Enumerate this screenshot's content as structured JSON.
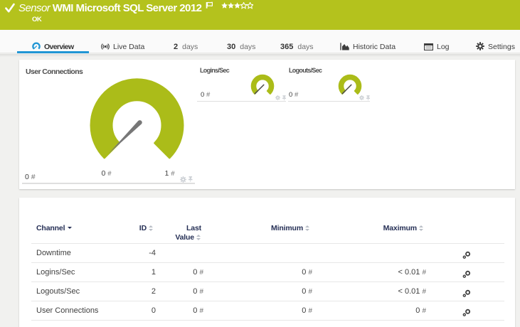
{
  "header": {
    "type_label": "Sensor",
    "title": "WMI Microsoft SQL Server 2012",
    "status": "OK",
    "rating": {
      "filled": 3,
      "total": 5
    },
    "colors": {
      "bar_green": "#b4c21d",
      "accent_blue": "#2196d4",
      "gauge_green": "#abbc19"
    }
  },
  "tabs": {
    "overview": {
      "label": "Overview"
    },
    "live_data": {
      "label": "Live Data"
    },
    "days2": {
      "num": "2",
      "unit": "days"
    },
    "days30": {
      "num": "30",
      "unit": "days"
    },
    "days365": {
      "num": "365",
      "unit": "days"
    },
    "historic": {
      "label": "Historic Data"
    },
    "log": {
      "label": "Log"
    },
    "settings": {
      "label": "Settings"
    }
  },
  "gauges": {
    "main": {
      "title": "User Connections",
      "value": "0",
      "unit": "#",
      "scale_min": "0",
      "scale_min_unit": "#",
      "scale_max": "1",
      "scale_max_unit": "#"
    },
    "tile1": {
      "title": "Logins/Sec",
      "value": "0",
      "unit": "#"
    },
    "tile2": {
      "title": "Logouts/Sec",
      "value": "0",
      "unit": "#"
    }
  },
  "table": {
    "columns": {
      "channel": "Channel",
      "id": "ID",
      "last1": "Last",
      "last2": "Value",
      "min": "Minimum",
      "max": "Maximum"
    },
    "rows": [
      {
        "channel": "Downtime",
        "id": "-4",
        "last": "",
        "last_unit": "",
        "min": "",
        "min_unit": "",
        "max": "",
        "max_unit": ""
      },
      {
        "channel": "Logins/Sec",
        "id": "1",
        "last": "0",
        "last_unit": "#",
        "min": "0",
        "min_unit": "#",
        "max": "< 0.01",
        "max_unit": "#"
      },
      {
        "channel": "Logouts/Sec",
        "id": "2",
        "last": "0",
        "last_unit": "#",
        "min": "0",
        "min_unit": "#",
        "max": "< 0.01",
        "max_unit": "#"
      },
      {
        "channel": "User Connections",
        "id": "0",
        "last": "0",
        "last_unit": "#",
        "min": "0",
        "min_unit": "#",
        "max": "0",
        "max_unit": "#"
      }
    ]
  }
}
